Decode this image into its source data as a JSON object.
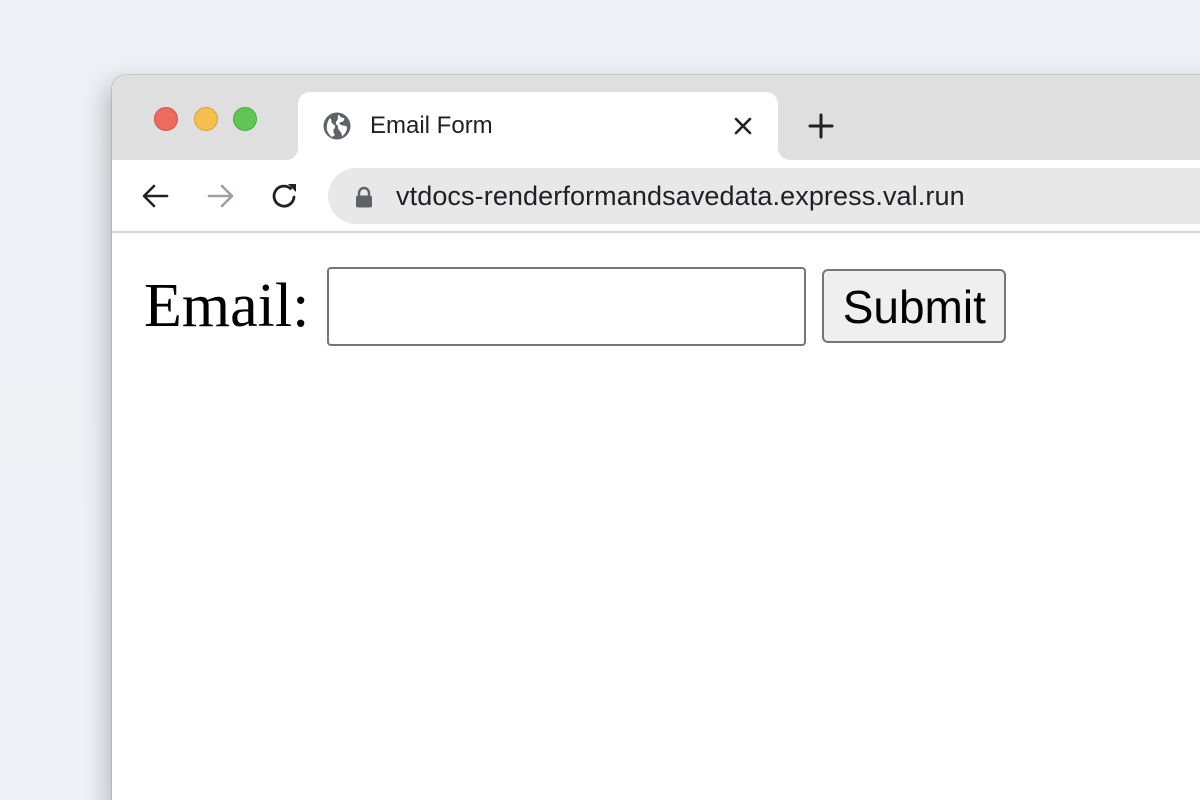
{
  "browser": {
    "tab": {
      "title": "Email Form",
      "favicon": "globe-icon"
    },
    "address_bar": {
      "url": "vtdocs-renderformandsavedata.express.val.run",
      "secure_icon": "lock-icon"
    },
    "icons": {
      "back": "back-arrow-icon",
      "forward": "forward-arrow-icon",
      "reload": "reload-icon",
      "close_tab": "close-icon",
      "new_tab": "plus-icon"
    },
    "window_controls": {
      "close_color": "#ed6a5e",
      "minimize_color": "#f5bf4f",
      "maximize_color": "#61c554"
    }
  },
  "page": {
    "form": {
      "email_label": "Email:",
      "email_value": "",
      "email_placeholder": "",
      "submit_label": "Submit"
    }
  }
}
